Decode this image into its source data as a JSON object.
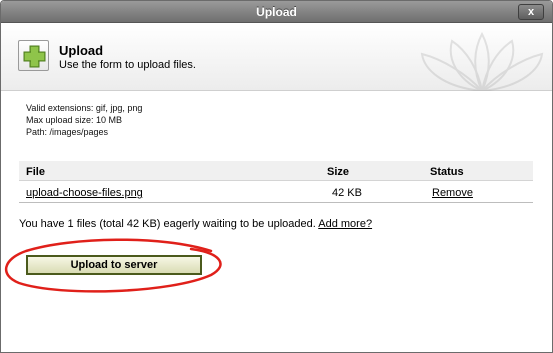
{
  "window": {
    "title": "Upload",
    "close_label": "x"
  },
  "header": {
    "title": "Upload",
    "subtitle": "Use the form to upload files.",
    "icon": "plus-icon"
  },
  "info": {
    "extensions": "Valid extensions: gif, jpg, png",
    "max_size": "Max upload size: 10 MB",
    "path": "Path: /images/pages"
  },
  "table": {
    "columns": [
      "File",
      "Size",
      "Status"
    ],
    "rows": [
      {
        "file": "upload-choose-files.png",
        "size": "42 KB",
        "status": "Remove"
      }
    ]
  },
  "summary": {
    "text": "You have 1 files (total 42 KB) eagerly waiting to be uploaded.",
    "link": "Add more?"
  },
  "actions": {
    "upload_label": "Upload to server"
  },
  "colors": {
    "accent": "#4b5a1c",
    "annotation": "#e0201a",
    "plus_green": "#7bb13a"
  }
}
